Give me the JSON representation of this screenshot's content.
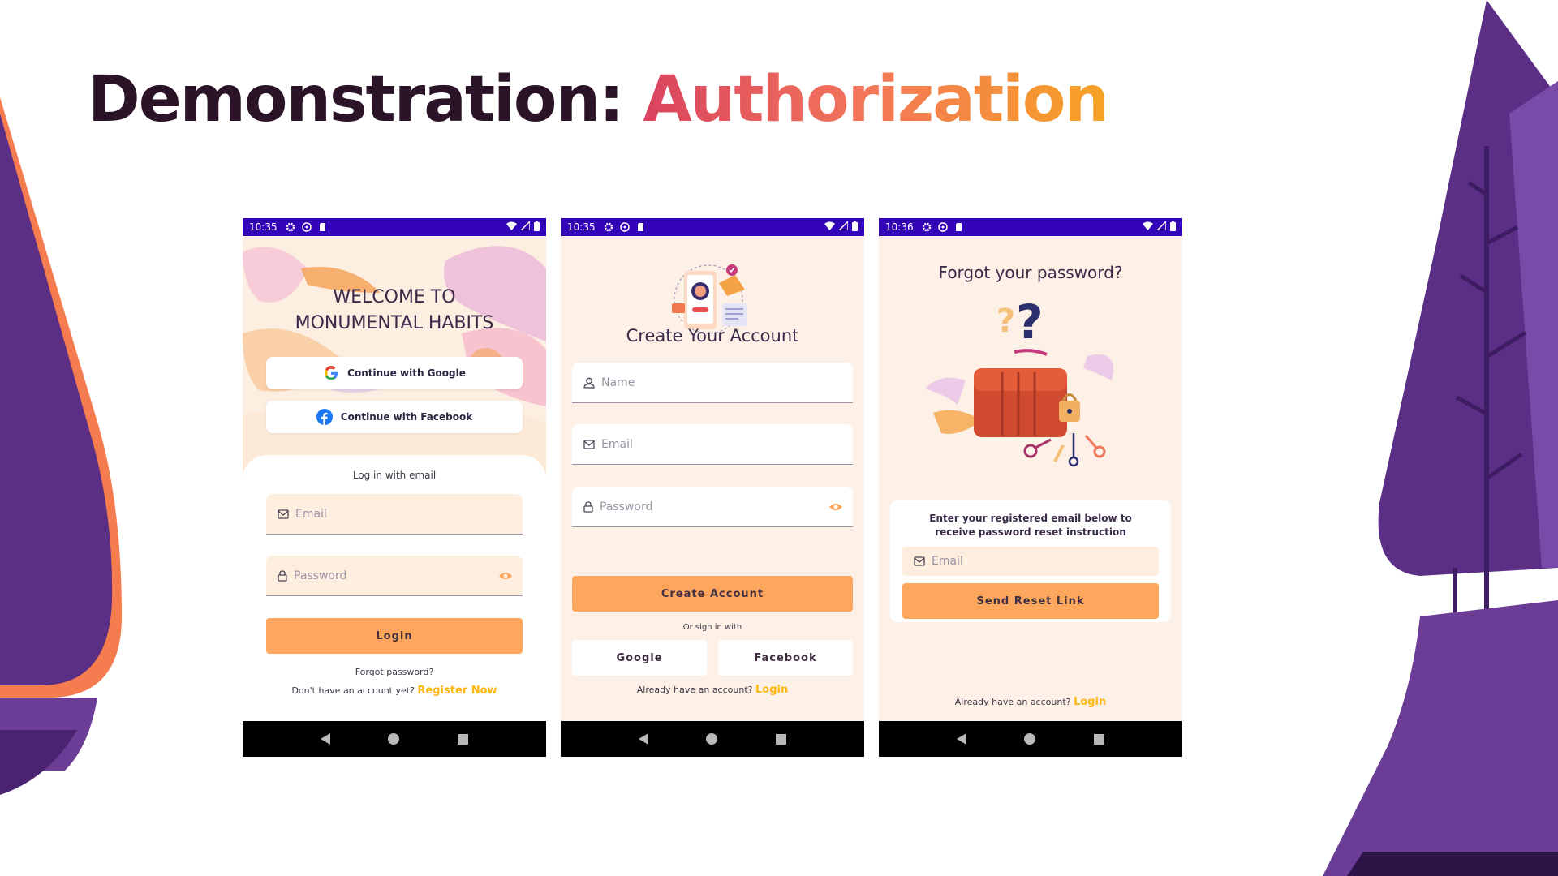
{
  "slide": {
    "title_part1": "Demonstration: ",
    "title_part2": "Authorization"
  },
  "colors": {
    "status_bar": "#3405b8",
    "screen_bg": "#fdf0e6",
    "button_orange": "#fda65d",
    "link_yellow": "#fdb813",
    "heading_dark": "#573353",
    "tree_purple": "#5b2f86"
  },
  "screens": {
    "login": {
      "status_time": "10:35",
      "title_line1": "WELCOME TO",
      "title_line2": "MONUMENTAL HABITS",
      "google_label": "Continue with Google",
      "facebook_label": "Continue with Facebook",
      "email_section_label": "Log in with email",
      "email_placeholder": "Email",
      "password_placeholder": "Password",
      "login_button": "Login",
      "forgot_password": "Forgot password?",
      "no_account_text": "Don't have an account yet?",
      "register_link": "Register Now"
    },
    "register": {
      "status_time": "10:35",
      "title": "Create Your Account",
      "name_placeholder": "Name",
      "email_placeholder": "Email",
      "password_placeholder": "Password",
      "create_button": "Create Account",
      "or_sign_in": "Or sign in with",
      "google_button": "Google",
      "facebook_button": "Facebook",
      "have_account_text": "Already have an account?",
      "login_link": "Login"
    },
    "forgot": {
      "status_time": "10:36",
      "title": "Forgot your password?",
      "instruction": "Enter your registered email below to receive password reset instruction",
      "email_placeholder": "Email",
      "send_button": "Send Reset Link",
      "have_account_text": "Already have an account?",
      "login_link": "Login"
    }
  },
  "icons": {
    "status": [
      "gear-icon",
      "accessibility-icon",
      "sd-card-icon",
      "wifi-icon",
      "signal-icon",
      "battery-icon"
    ],
    "nav": [
      "back-icon",
      "home-icon",
      "recents-icon"
    ]
  }
}
